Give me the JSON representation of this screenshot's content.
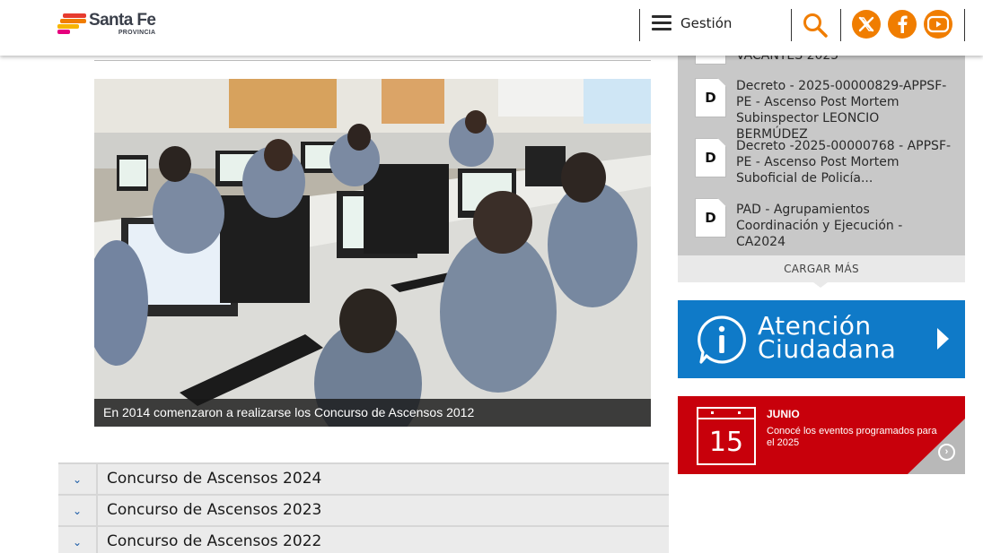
{
  "header": {
    "logo_title": "Santa Fe",
    "logo_subtitle": "PROVINCIA",
    "menu_label": "Gestión",
    "icons": [
      "hamburger-icon",
      "search-icon",
      "x-twitter-icon",
      "facebook-icon",
      "youtube-icon"
    ],
    "accent_color": "#f07d00"
  },
  "main": {
    "photo_caption": "En 2014 comenzaron a realizarse los Concurso de Ascensos 2012",
    "accordion": [
      {
        "label": "Concurso de Ascensos 2024"
      },
      {
        "label": "Concurso de Ascensos 2023"
      },
      {
        "label": "Concurso de Ascensos 2022"
      }
    ]
  },
  "sidebar": {
    "partial_doc_text": "VACANTES 2025",
    "docs": [
      {
        "icon_letter": "D",
        "title": "Decreto - 2025-00000829-APPSF-PE - Ascenso Post Mortem Subinspector LEONCIO BERMÚDEZ"
      },
      {
        "icon_letter": "D",
        "title": "Decreto -2025-00000768 - APPSF- PE - Ascenso Post Mortem Suboficial de Policía..."
      },
      {
        "icon_letter": "D",
        "title": "PAD - Agrupamientos Coordinación y Ejecución - CA2024"
      }
    ],
    "load_more_label": "CARGAR MÁS",
    "atencion": {
      "line1": "Atención",
      "line2": "Ciudadana",
      "color": "#0f7ac8"
    },
    "agenda": {
      "day": "15",
      "month": "JUNIO",
      "description": "Conocé los eventos programados para el 2025",
      "color": "#c8000b"
    }
  }
}
